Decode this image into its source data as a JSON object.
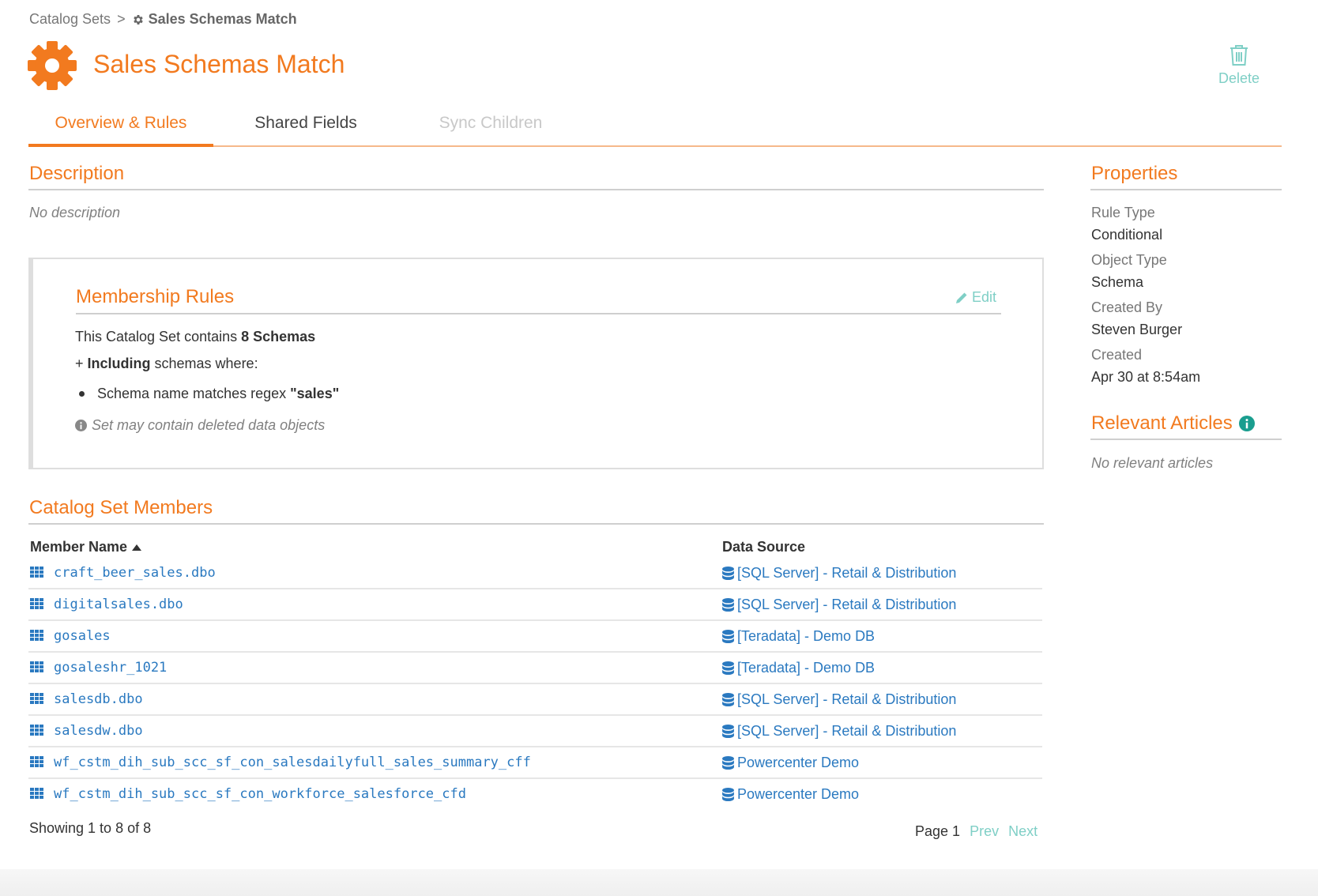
{
  "breadcrumb": {
    "parent": "Catalog Sets",
    "separator": ">",
    "current": "Sales Schemas Match"
  },
  "header": {
    "title": "Sales Schemas Match",
    "delete_label": "Delete"
  },
  "tabs": [
    {
      "label": "Overview & Rules",
      "state": "active"
    },
    {
      "label": "Shared Fields",
      "state": "inactive"
    },
    {
      "label": "Sync Children",
      "state": "disabled"
    }
  ],
  "description": {
    "title": "Description",
    "text": "No description"
  },
  "membership": {
    "title": "Membership Rules",
    "edit_label": "Edit",
    "contains_prefix": "This Catalog Set contains ",
    "contains_count": "8 Schemas",
    "including_prefix": "+ ",
    "including_bold": "Including",
    "including_suffix": " schemas where:",
    "rule_prefix": "Schema name matches regex ",
    "rule_value": "\"sales\"",
    "note": "Set may contain deleted data objects"
  },
  "members": {
    "title": "Catalog Set Members",
    "col_name": "Member Name",
    "col_source": "Data Source",
    "rows": [
      {
        "name": "craft_beer_sales.dbo",
        "source": "[SQL Server] - Retail & Distribution"
      },
      {
        "name": "digitalsales.dbo",
        "source": "[SQL Server] - Retail & Distribution"
      },
      {
        "name": "gosales",
        "source": "[Teradata] - Demo DB"
      },
      {
        "name": "gosaleshr_1021",
        "source": "[Teradata] - Demo DB"
      },
      {
        "name": "salesdb.dbo",
        "source": "[SQL Server] - Retail & Distribution"
      },
      {
        "name": "salesdw.dbo",
        "source": "[SQL Server] - Retail & Distribution"
      },
      {
        "name": "wf_cstm_dih_sub_scc_sf_con_salesdailyfull_sales_summary_cff",
        "source": "Powercenter Demo"
      },
      {
        "name": "wf_cstm_dih_sub_scc_sf_con_workforce_salesforce_cfd",
        "source": "Powercenter Demo"
      }
    ],
    "showing": "Showing 1 to 8 of 8",
    "page_label": "Page 1",
    "prev_label": "Prev",
    "next_label": "Next"
  },
  "properties": {
    "title": "Properties",
    "items": [
      {
        "label": "Rule Type",
        "value": "Conditional"
      },
      {
        "label": "Object Type",
        "value": "Schema"
      },
      {
        "label": "Created By",
        "value": "Steven Burger"
      },
      {
        "label": "Created",
        "value": "Apr 30 at 8:54am"
      }
    ]
  },
  "articles": {
    "title": "Relevant Articles",
    "empty": "No relevant articles"
  },
  "colors": {
    "accent": "#f27a1f",
    "link": "#2a79c0",
    "teal": "#7fcfc6",
    "info_icon": "#1a9e8f"
  },
  "icons": [
    "gear-icon",
    "trash-icon",
    "pencil-icon",
    "info-icon",
    "table-grid-icon",
    "database-icon",
    "sort-asc-icon"
  ]
}
